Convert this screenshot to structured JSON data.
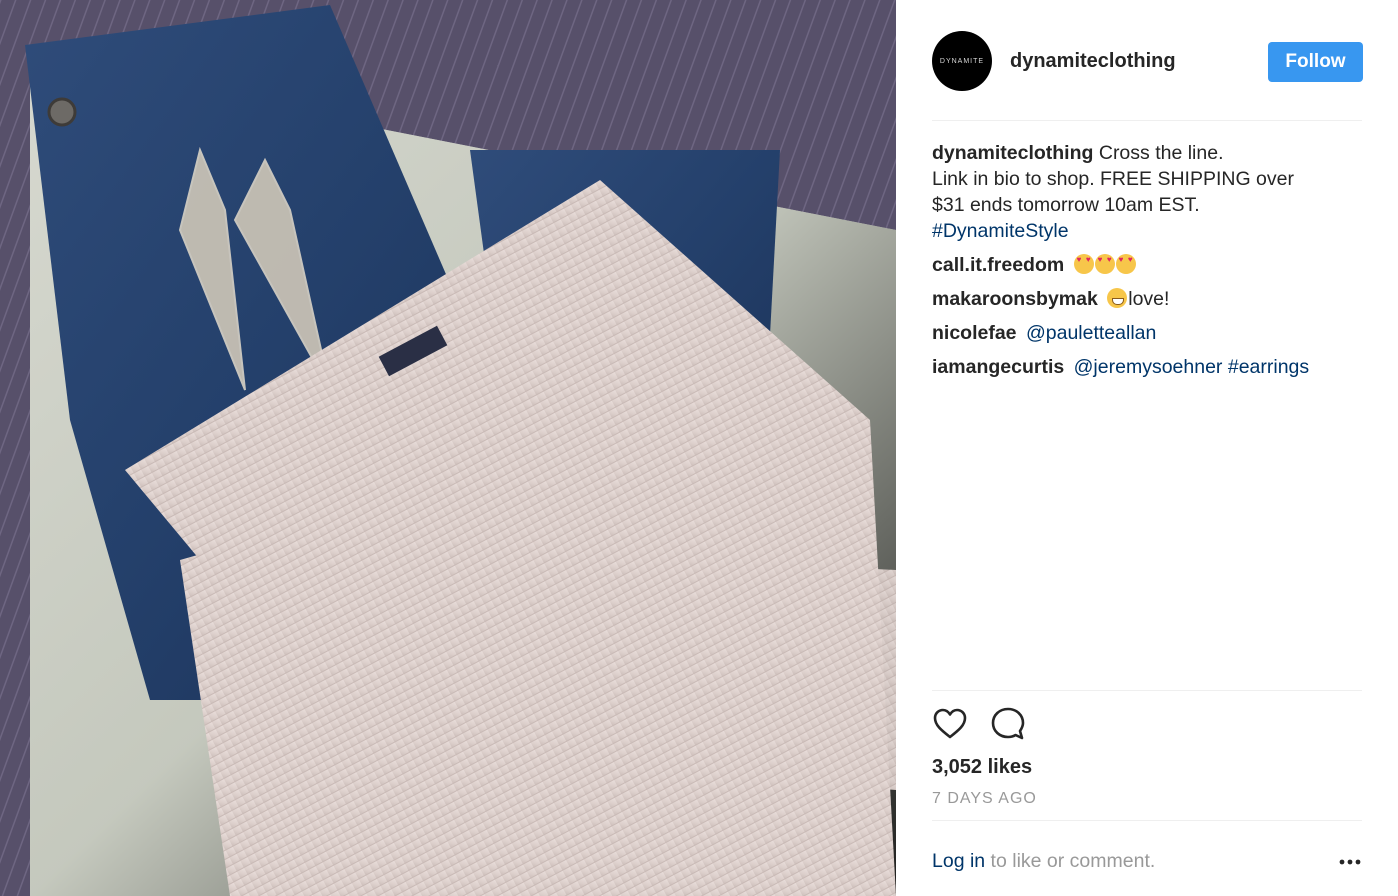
{
  "header": {
    "avatar_text": "DYNAMITE",
    "username": "dynamiteclothing",
    "follow_label": "Follow"
  },
  "caption": {
    "username": "dynamiteclothing",
    "line1": "Cross the line.",
    "line2": "Link in bio to shop. FREE SHIPPING over",
    "line3": "$31 ends tomorrow 10am EST.",
    "hashtag": "#DynamiteStyle"
  },
  "comments": [
    {
      "username": "call.it.freedom",
      "text": "",
      "emoji": "heart-eyes x3"
    },
    {
      "username": "makaroonsbymak",
      "text": "love!",
      "emoji": "grin"
    },
    {
      "username": "nicolefae",
      "mention": "@pauletteallan"
    },
    {
      "username": "iamangecurtis",
      "mention": "@jeremysoehner",
      "hashtag": "#earrings"
    }
  ],
  "actions": {
    "like_icon": "heart-outline-icon",
    "comment_icon": "comment-bubble-icon"
  },
  "likes": "3,052 likes",
  "time_ago": "7 DAYS AGO",
  "footer": {
    "login_link": "Log in",
    "login_rest": " to like or comment.",
    "more_icon": "ellipsis-icon"
  },
  "colors": {
    "follow_button": "#3897f0",
    "link": "#003569",
    "muted": "#999999",
    "divider": "#efefef"
  }
}
